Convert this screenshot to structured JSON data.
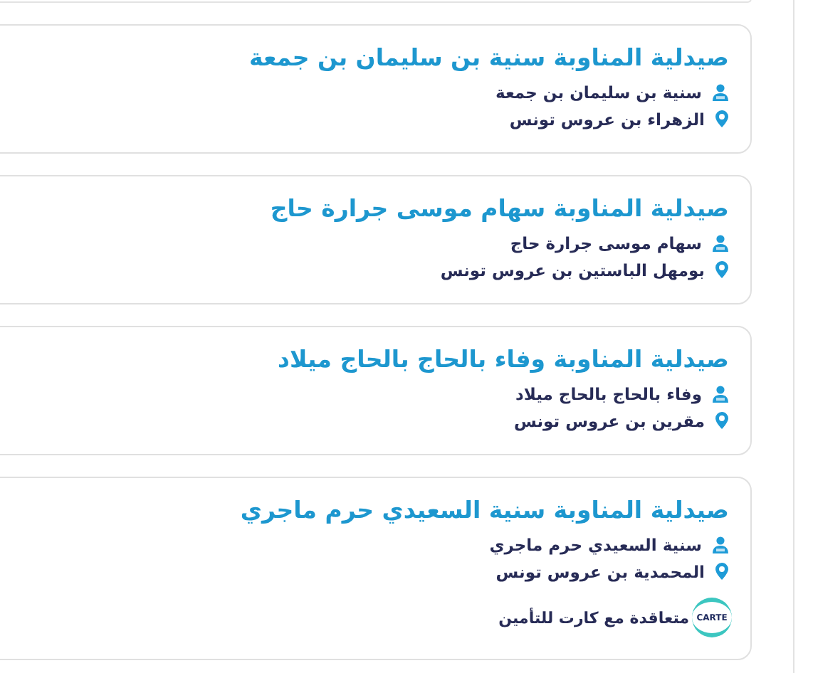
{
  "pharmacies": [
    {
      "title": "صيدلية المناوبة سنية بن سليمان بن جمعة",
      "owner": "سنية بن سليمان بن جمعة",
      "address": "الزهراء بن عروس تونس"
    },
    {
      "title": "صيدلية المناوبة سهام موسى جرارة حاج",
      "owner": "سهام موسى جرارة حاج",
      "address": "بومهل الباستين بن عروس تونس"
    },
    {
      "title": "صيدلية المناوبة وفاء بالحاج بالحاج ميلاد",
      "owner": "وفاء بالحاج بالحاج ميلاد",
      "address": "مقرين بن عروس تونس"
    },
    {
      "title": "صيدلية المناوبة سنية السعيدي حرم ماجري",
      "owner": "سنية السعيدي حرم ماجري",
      "address": "المحمدية بن عروس تونس",
      "insurance": {
        "logo_text": "CARTE",
        "label": "متعاقدة مع كارت للتأمين"
      }
    }
  ]
}
